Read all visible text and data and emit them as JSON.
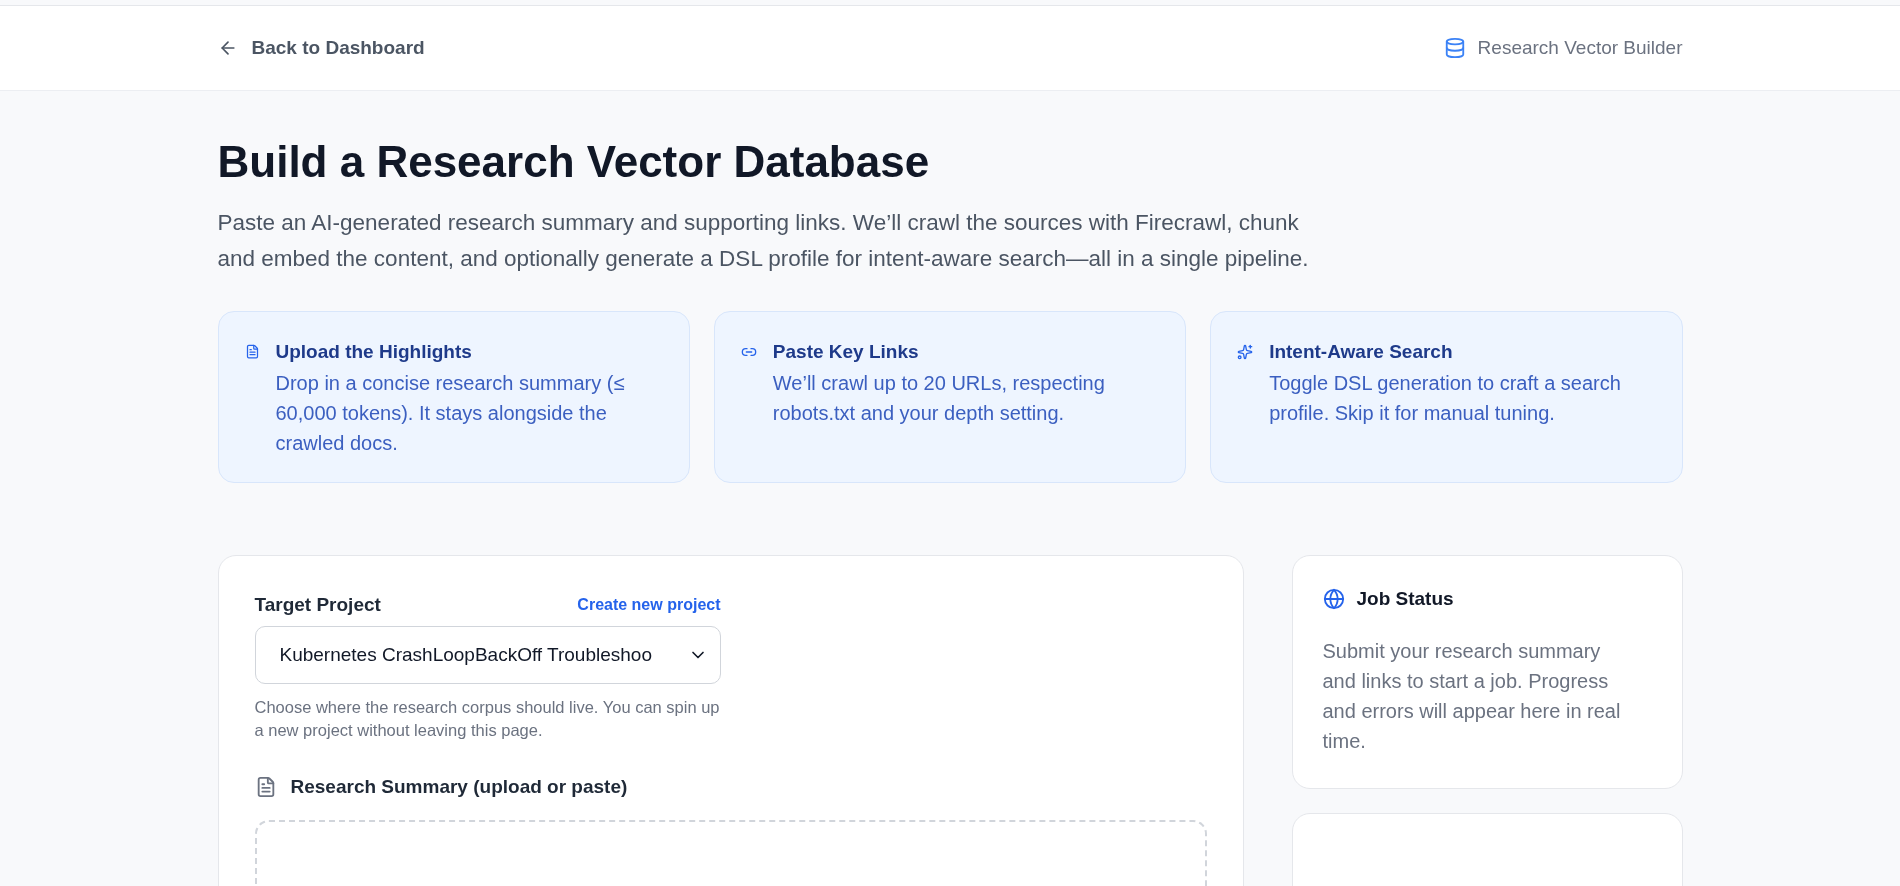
{
  "header": {
    "back_link": "Back to Dashboard",
    "app_name": "Research Vector Builder"
  },
  "page": {
    "title": "Build a Research Vector Database",
    "intro": "Paste an AI-generated research summary and supporting links. We’ll crawl the sources with Firecrawl, chunk and embed the content, and optionally generate a DSL profile for intent-aware search—all in a single pipeline."
  },
  "feature_cards": [
    {
      "kind": "document",
      "title": "Upload the Highlights",
      "text": "Drop in a concise research summary (≤ 60,000 tokens). It stays alongside the crawled docs."
    },
    {
      "kind": "link",
      "title": "Paste Key Links",
      "text": "We’ll crawl up to 20 URLs, respecting robots.txt and your depth setting."
    },
    {
      "kind": "sparkles",
      "title": "Intent-Aware Search",
      "text": "Toggle DSL generation to craft a search profile. Skip it for manual tuning."
    }
  ],
  "form": {
    "target_project": {
      "label": "Target Project",
      "create_link": "Create new project",
      "value": "Kubernetes CrashLoopBackOff Troubleshoo",
      "help": "Choose where the research corpus should live. You can spin up a new project without leaving this page."
    },
    "summary_section": {
      "label": "Research Summary (upload or paste)"
    }
  },
  "job_status": {
    "title": "Job Status",
    "text": "Submit your research summary and links to start a job. Progress and errors will appear here in real time."
  }
}
